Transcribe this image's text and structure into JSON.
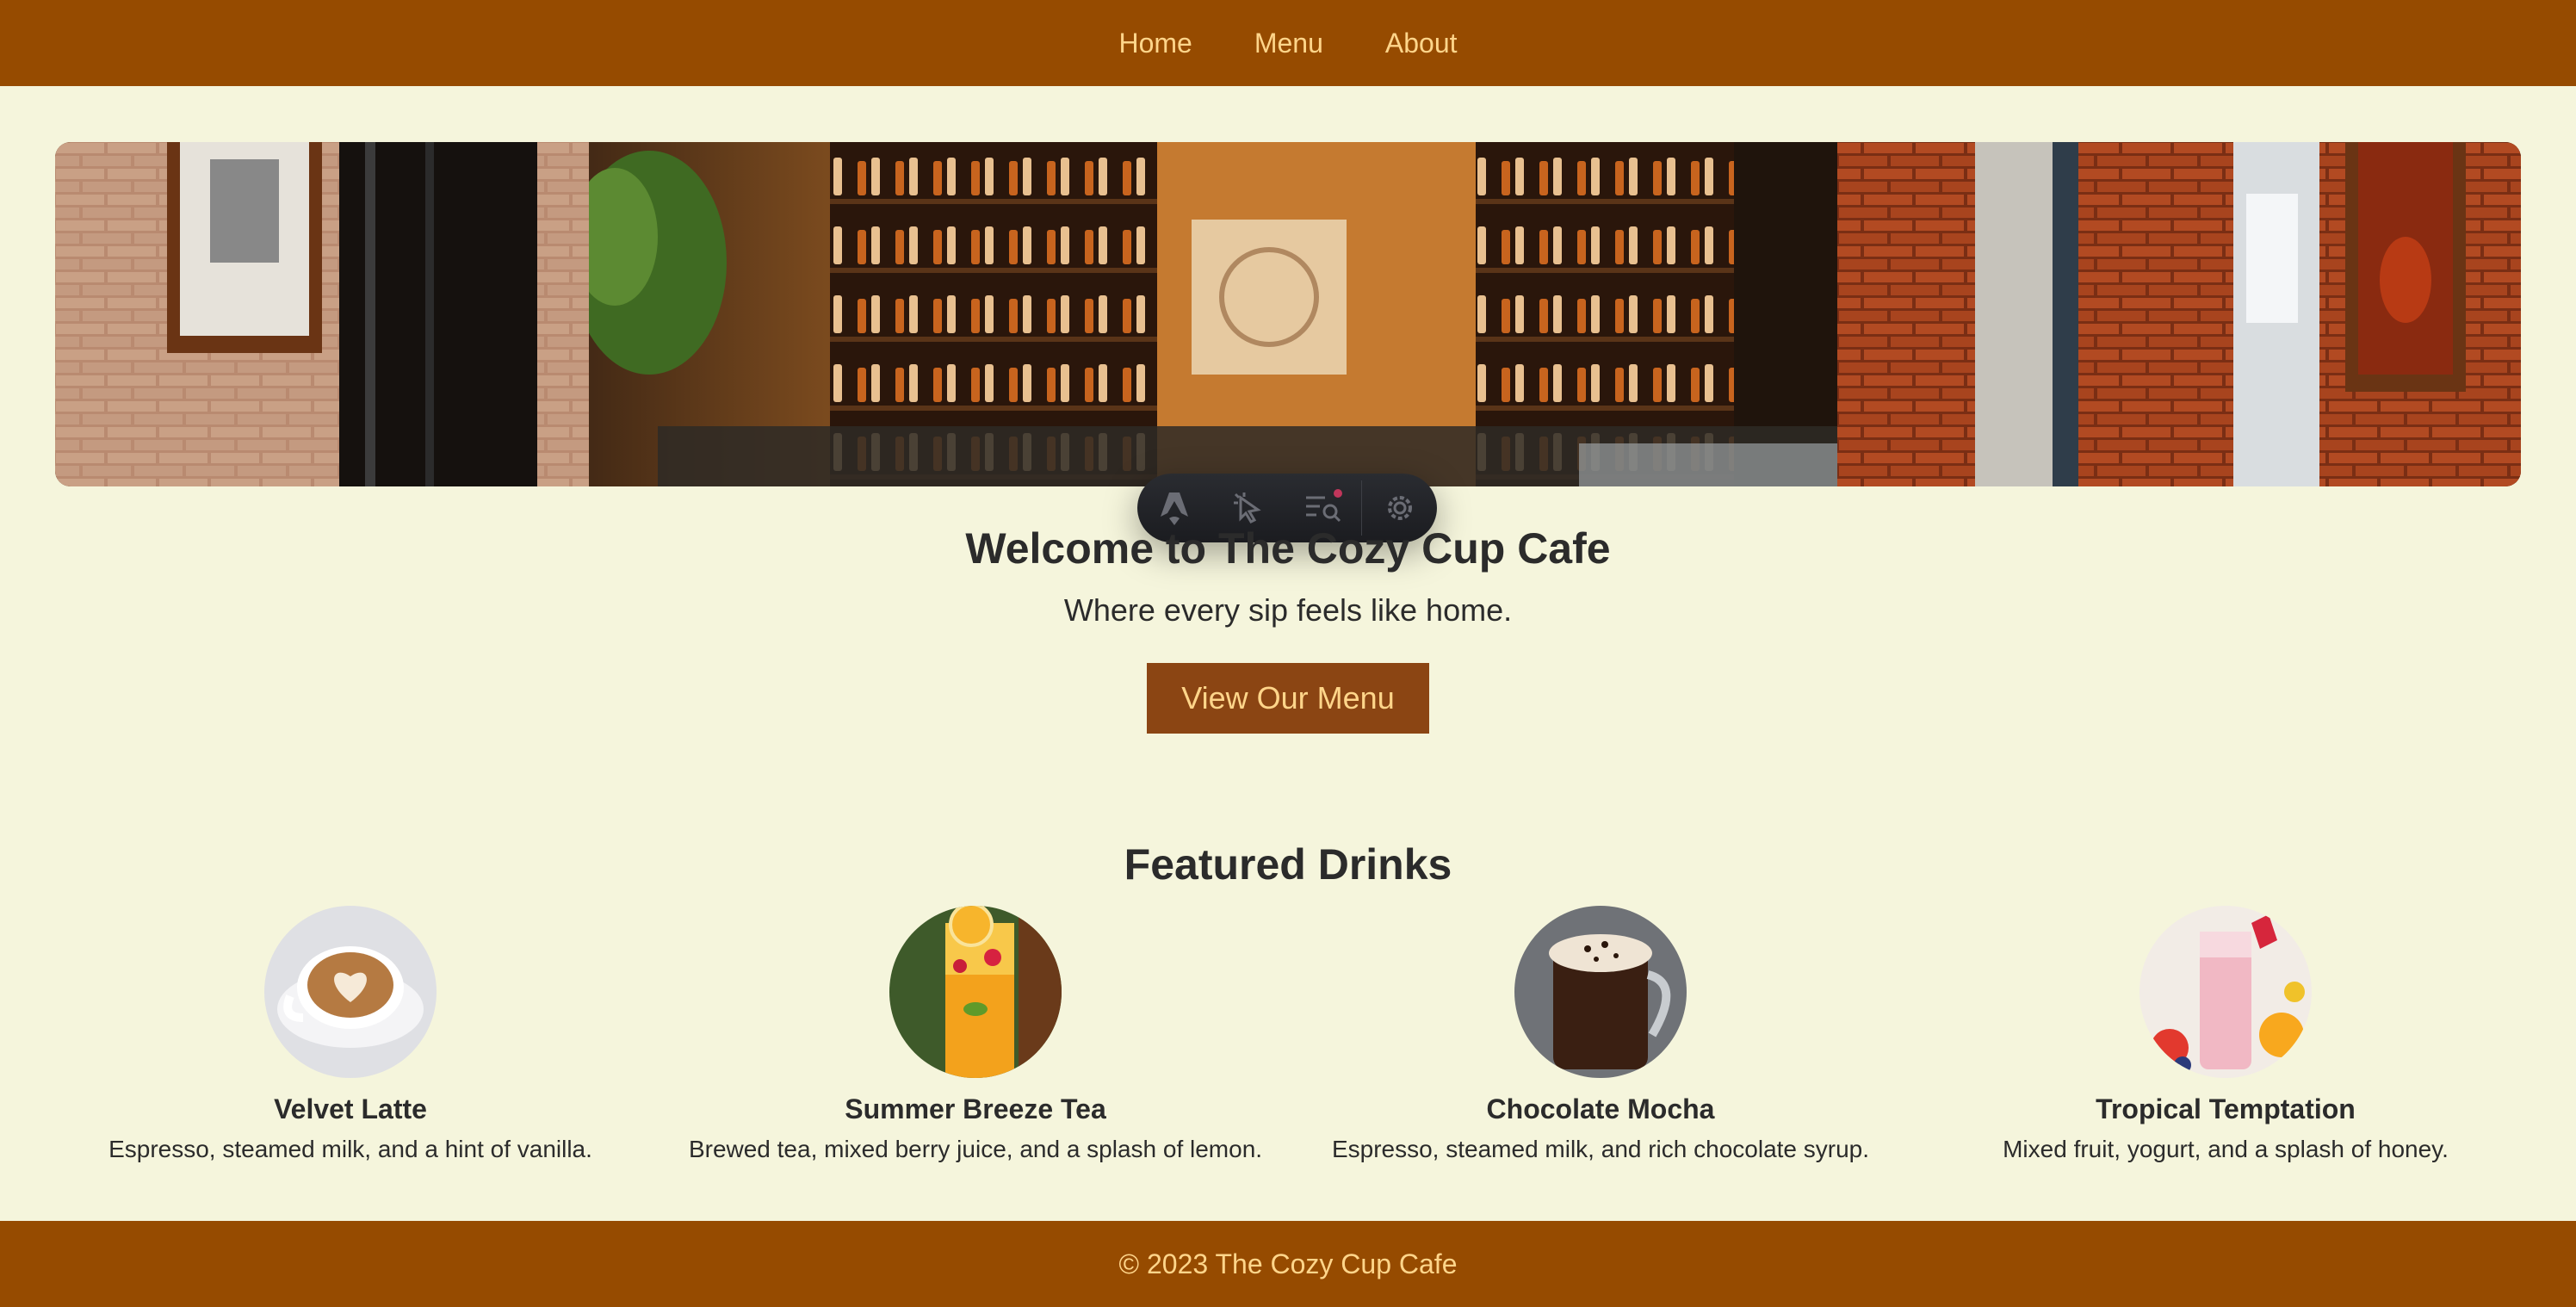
{
  "nav": {
    "items": [
      {
        "label": "Home"
      },
      {
        "label": "Menu"
      },
      {
        "label": "About"
      }
    ]
  },
  "hero": {
    "image": "cafe-interior-photo"
  },
  "toolbar": {
    "icons": [
      "astro-logo-icon",
      "cursor-inspect-icon",
      "audit-list-icon",
      "settings-gear-icon"
    ]
  },
  "welcome": {
    "title": "Welcome to The Cozy Cup Cafe",
    "subtitle": "Where every sip feels like home.",
    "button_label": "View Our Menu"
  },
  "featured": {
    "title": "Featured Drinks",
    "drinks": [
      {
        "name": "Velvet Latte",
        "description": "Espresso, steamed milk, and a hint of vanilla."
      },
      {
        "name": "Summer Breeze Tea",
        "description": "Brewed tea, mixed berry juice, and a splash of lemon."
      },
      {
        "name": "Chocolate Mocha",
        "description": "Espresso, steamed milk, and rich chocolate syrup."
      },
      {
        "name": "Tropical Temptation",
        "description": "Mixed fruit, yogurt, and a splash of honey."
      }
    ]
  },
  "footer": {
    "text": "© 2023 The Cozy Cup Cafe"
  },
  "colors": {
    "brand": "#964b00",
    "button": "#8b4513",
    "background": "#f5f5dc",
    "accent_text": "#ffd58a"
  }
}
